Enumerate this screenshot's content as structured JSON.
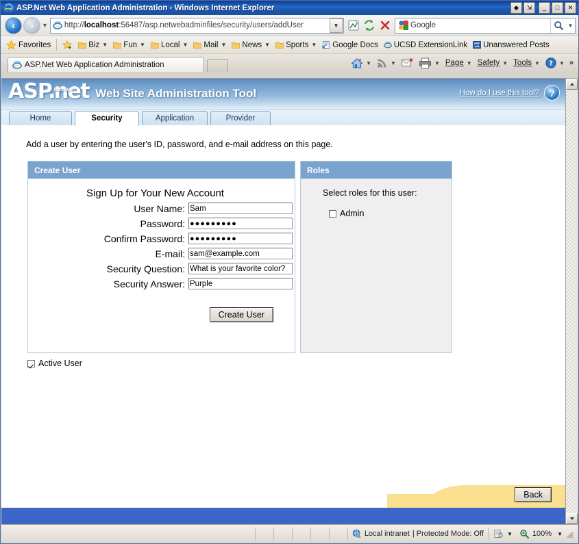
{
  "window": {
    "title": "ASP.Net Web Application Administration - Windows Internet Explorer",
    "icon": "ie-logo-icon",
    "buttons": {
      "restore_group": "restore-group-button",
      "restore_down_alt": "restore-window-button",
      "minimize": "_",
      "maximize": "□",
      "close": "✕"
    }
  },
  "navbar": {
    "back": "back-button",
    "forward": "forward-button",
    "recent_pages": "recent-pages-dropdown",
    "address": {
      "scheme": "http://",
      "host": "localhost",
      "rest": ":56487/asp.netwebadminfiles/security/users/addUser",
      "full": "http://localhost:56487/asp.netwebadminfiles/security/users/addUser",
      "icon": "page-favicon-icon",
      "dropdown": "address-history-dropdown"
    },
    "compat_button": "compatibility-view-button",
    "refresh_button": "refresh-button",
    "stop_button": "stop-button",
    "search": {
      "provider_icon": "google-icon",
      "placeholder": "Google",
      "value": "",
      "go_icon": "search-icon",
      "dropdown": "search-provider-dropdown"
    }
  },
  "favorites_bar": {
    "favorites_label": "Favorites",
    "add_button": "add-to-favorites-bar-button",
    "items": [
      {
        "label": "Biz",
        "icon": "folder-icon",
        "has_caret": true
      },
      {
        "label": "Fun",
        "icon": "folder-icon",
        "has_caret": true
      },
      {
        "label": "Local",
        "icon": "folder-icon",
        "has_caret": true
      },
      {
        "label": "Mail",
        "icon": "folder-icon",
        "has_caret": true
      },
      {
        "label": "News",
        "icon": "folder-icon",
        "has_caret": true
      },
      {
        "label": "Sports",
        "icon": "folder-icon",
        "has_caret": true
      },
      {
        "label": "Google Docs",
        "icon": "google-docs-icon",
        "has_caret": false
      },
      {
        "label": "UCSD ExtensionLink",
        "icon": "ie-logo-icon",
        "has_caret": false
      },
      {
        "label": "Unanswered Posts",
        "icon": "aspnet-icon",
        "has_caret": false
      }
    ]
  },
  "browser_tabs": {
    "tabs": [
      {
        "label": "ASP.Net Web Application Administration",
        "icon": "ie-logo-icon",
        "active": true
      }
    ],
    "new_tab": "new-tab-button"
  },
  "command_bar": {
    "items": [
      {
        "label": "",
        "icon": "home-icon",
        "has_caret": true
      },
      {
        "label": "",
        "icon": "feeds-icon",
        "has_caret": true
      },
      {
        "label": "",
        "icon": "read-mail-icon",
        "has_caret": false
      },
      {
        "label": "",
        "icon": "print-icon",
        "has_caret": true
      },
      {
        "label": "Page",
        "icon": "",
        "has_caret": true
      },
      {
        "label": "Safety",
        "icon": "",
        "has_caret": true
      },
      {
        "label": "Tools",
        "icon": "",
        "has_caret": true
      },
      {
        "label": "",
        "icon": "help-icon",
        "has_caret": true
      }
    ],
    "overflow": "»"
  },
  "page": {
    "banner": {
      "logo_asp": "ASP.",
      "logo_microsoft": "Microsoft",
      "logo_net": "net",
      "title": "Web Site Administration Tool",
      "help_link": "How do I use this tool?",
      "help_icon": "question-mark-icon"
    },
    "tabs": [
      {
        "label": "Home",
        "active": false
      },
      {
        "label": "Security",
        "active": true
      },
      {
        "label": "Application",
        "active": false
      },
      {
        "label": "Provider",
        "active": false
      }
    ],
    "intro": "Add a user by entering the user's ID, password, and e-mail address on this page.",
    "create_user_panel": {
      "header": "Create User",
      "form_title": "Sign Up for Your New Account",
      "fields": [
        {
          "label": "User Name:",
          "value": "Sam",
          "type": "text",
          "name": "user-name-field"
        },
        {
          "label": "Password:",
          "value": "●●●●●●●●●",
          "type": "password",
          "name": "password-field"
        },
        {
          "label": "Confirm Password:",
          "value": "●●●●●●●●●",
          "type": "password",
          "name": "confirm-password-field"
        },
        {
          "label": "E-mail:",
          "value": "sam@example.com",
          "type": "text",
          "name": "email-field"
        },
        {
          "label": "Security Question:",
          "value": "What is your favorite color?",
          "type": "text",
          "name": "security-question-field"
        },
        {
          "label": "Security Answer:",
          "value": "Purple",
          "type": "text",
          "name": "security-answer-field"
        }
      ],
      "submit_label": "Create User"
    },
    "roles_panel": {
      "header": "Roles",
      "instruction": "Select roles for this user:",
      "roles": [
        {
          "label": "Admin",
          "checked": false
        }
      ]
    },
    "active_user": {
      "label": "Active User",
      "checked": true
    },
    "back_label": "Back",
    "colors": {
      "banner_blue": "#6e9ccb",
      "panel_header": "#7ba3cf",
      "footer_yellow": "#fadf8e",
      "footer_blue": "#3c65c8"
    }
  },
  "status_bar": {
    "zone": "Local intranet",
    "zone_icon": "internet-zone-icon",
    "protected_mode": "| Protected Mode: Off",
    "privacy_icon": "privacy-report-icon",
    "zoom_icon": "zoom-icon",
    "zoom": "100%",
    "zoom_caret": "▾"
  }
}
